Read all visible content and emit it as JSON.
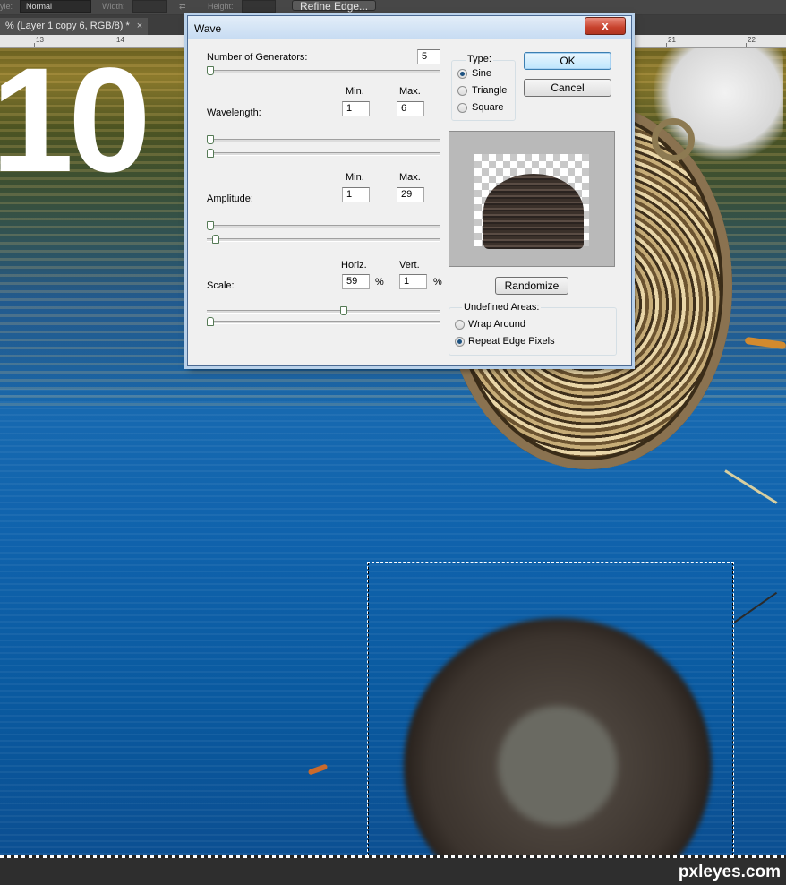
{
  "options_bar": {
    "style_label": "yle:",
    "style_value": "Normal",
    "width_label": "Width:",
    "height_label": "Height:",
    "refine_edge_label": "Refine Edge..."
  },
  "document_tab": {
    "title": "% (Layer 1 copy 6, RGB/8) *",
    "close": "×"
  },
  "ruler": {
    "marks": [
      "13",
      "14",
      "21",
      "22"
    ]
  },
  "canvas": {
    "big_number": "10"
  },
  "watermark": "pxleyes.com",
  "wave_dialog": {
    "title": "Wave",
    "close_label": "x",
    "generators_label": "Number of Generators:",
    "generators_value": "5",
    "wavelength_label": "Wavelength:",
    "amplitude_label": "Amplitude:",
    "scale_label": "Scale:",
    "min_label": "Min.",
    "max_label": "Max.",
    "horiz_label": "Horiz.",
    "vert_label": "Vert.",
    "percent": "%",
    "wavelength_min": "1",
    "wavelength_max": "6",
    "amplitude_min": "1",
    "amplitude_max": "29",
    "scale_horiz": "59",
    "scale_vert": "1",
    "type_group_title": "Type:",
    "type_options": [
      "Sine",
      "Triangle",
      "Square"
    ],
    "type_selected": "Sine",
    "ok_label": "OK",
    "cancel_label": "Cancel",
    "randomize_label": "Randomize",
    "undefined_group_title": "Undefined Areas:",
    "undefined_options": [
      "Wrap Around",
      "Repeat Edge Pixels"
    ],
    "undefined_selected": "Repeat Edge Pixels"
  }
}
